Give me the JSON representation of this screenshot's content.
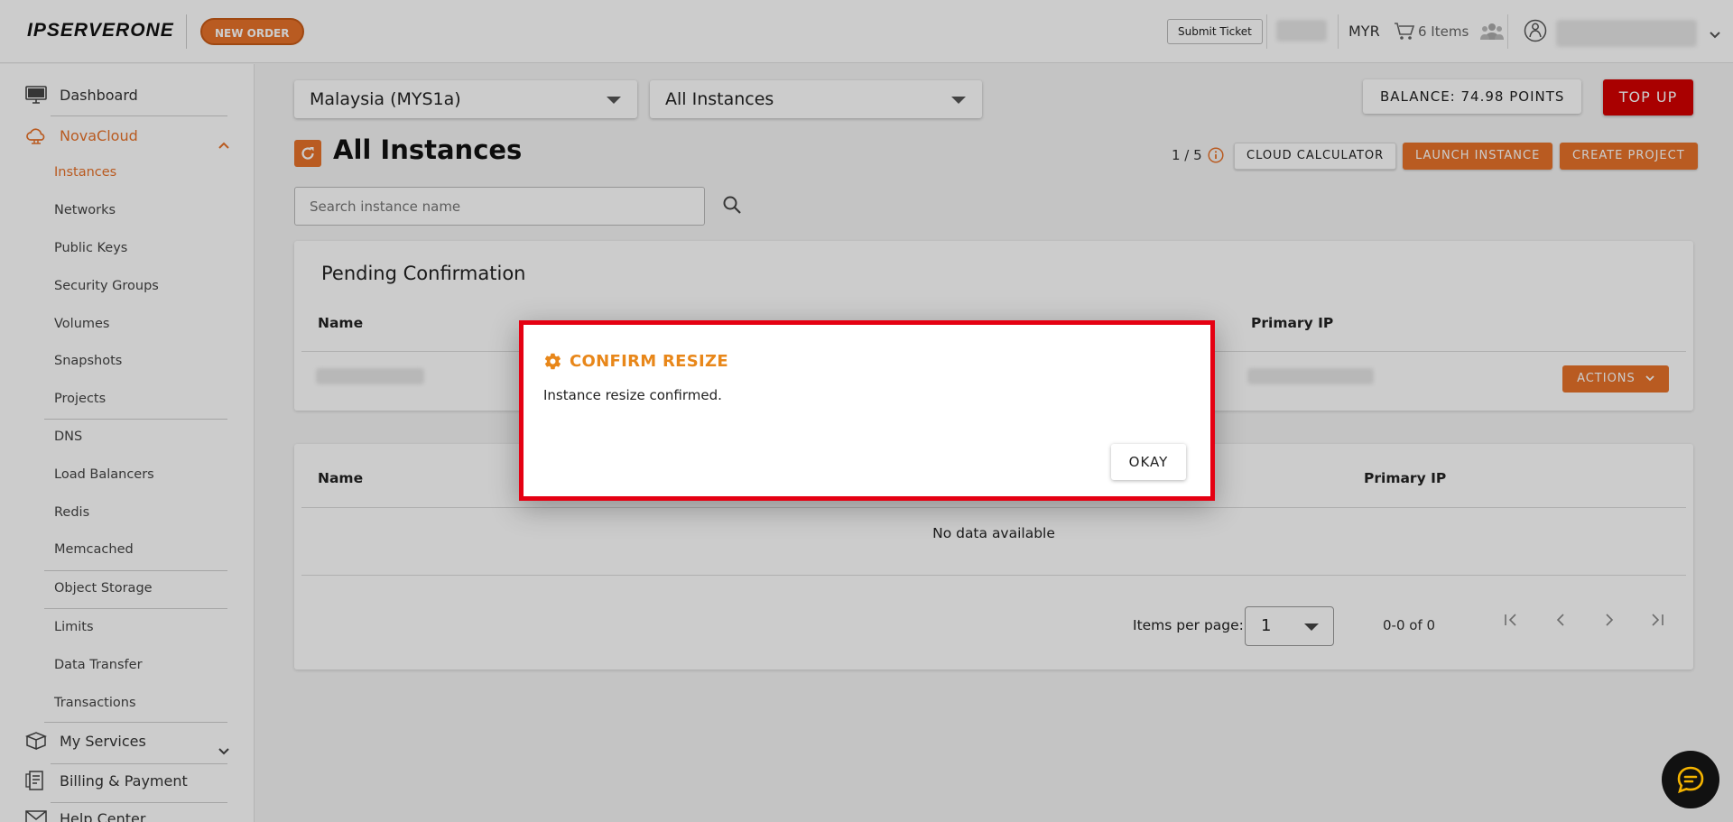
{
  "header": {
    "logo_text": "IPSERVERONE",
    "new_order_label": "NEW ORDER",
    "submit_ticket_label": "Submit Ticket",
    "currency": "MYR",
    "cart_label": "6 Items"
  },
  "sidebar": {
    "dashboard": "Dashboard",
    "novacloud": "NovaCloud",
    "sub_items": [
      "Instances",
      "Networks",
      "Public Keys",
      "Security Groups",
      "Volumes",
      "Snapshots",
      "Projects",
      "DNS",
      "Load Balancers",
      "Redis",
      "Memcached",
      "Object Storage",
      "Limits",
      "Data Transfer",
      "Transactions"
    ],
    "my_services": "My Services",
    "billing": "Billing & Payment",
    "help_center": "Help Center"
  },
  "filters": {
    "region": "Malaysia (MYS1a)",
    "instance_filter": "All Instances"
  },
  "balance_label": "BALANCE: 74.98 POINTS",
  "top_up_label": "TOP UP",
  "page_title": "All Instances",
  "quota": "1 / 5",
  "buttons": {
    "cloud_calculator": "CLOUD CALCULATOR",
    "launch_instance": "LAUNCH INSTANCE",
    "create_project": "CREATE PROJECT"
  },
  "search": {
    "placeholder": "Search instance name"
  },
  "pending": {
    "title": "Pending Confirmation",
    "col_name": "Name",
    "col_primary_ip": "Primary IP",
    "actions_label": "ACTIONS"
  },
  "instances_table": {
    "col_name": "Name",
    "col_primary_ip": "Primary IP",
    "empty_text": "No data available",
    "items_per_page_label": "Items per page:",
    "items_per_page_value": "1",
    "range_text": "0-0 of 0"
  },
  "dialog": {
    "title": "CONFIRM RESIZE",
    "message": "Instance resize confirmed.",
    "okay_label": "OKAY"
  },
  "colors": {
    "accent": "#e8722a",
    "danger": "#d40000",
    "dialog_border": "#e50012",
    "dialog_title": "#e8871a"
  }
}
